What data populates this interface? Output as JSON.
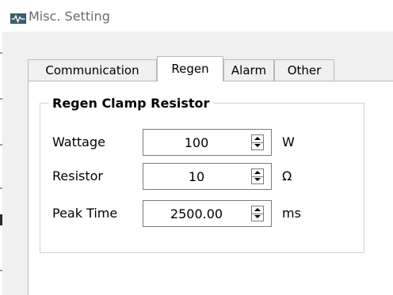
{
  "window": {
    "title": "Misc. Setting",
    "icon": "pulse-chart-icon"
  },
  "tabs": [
    {
      "label": "Communication",
      "active": false
    },
    {
      "label": "Regen",
      "active": true
    },
    {
      "label": "Alarm",
      "active": false
    },
    {
      "label": "Other",
      "active": false
    }
  ],
  "group": {
    "title": "Regen Clamp Resistor"
  },
  "fields": [
    {
      "label": "Wattage",
      "value": "100",
      "unit": "W"
    },
    {
      "label": "Resistor",
      "value": "10",
      "unit": "Ω"
    },
    {
      "label": "Peak Time",
      "value": "2500.00",
      "unit": "ms"
    }
  ],
  "colors": {
    "background": "#f0f0f0",
    "panel": "#ffffff",
    "border": "#b9b9b9",
    "title_text": "#6b6b6b"
  }
}
